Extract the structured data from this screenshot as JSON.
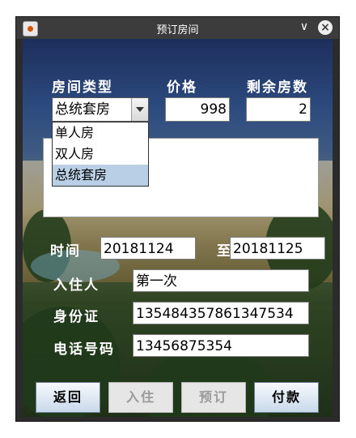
{
  "window": {
    "title": "预订房间"
  },
  "labels": {
    "room_type": "房间类型",
    "price": "价格",
    "remaining": "剩余房数",
    "time": "时间",
    "to": "至",
    "guest": "入住人",
    "id_card": "身份证",
    "phone": "电话号码"
  },
  "room_type": {
    "selected": "总统套房",
    "options": [
      "单人房",
      "双人房",
      "总统套房"
    ]
  },
  "fields": {
    "price": "998",
    "remaining": "2",
    "start_date": "20181124",
    "end_date": "20181125",
    "guest": "第一次",
    "id_card": "135484357861347534",
    "phone": "13456875354"
  },
  "buttons": {
    "back": "返回",
    "checkin": "入住",
    "reserve": "预订",
    "pay": "付款"
  },
  "icons": [
    "app-icon",
    "minimize-icon",
    "close-icon",
    "chevron-down-icon"
  ]
}
